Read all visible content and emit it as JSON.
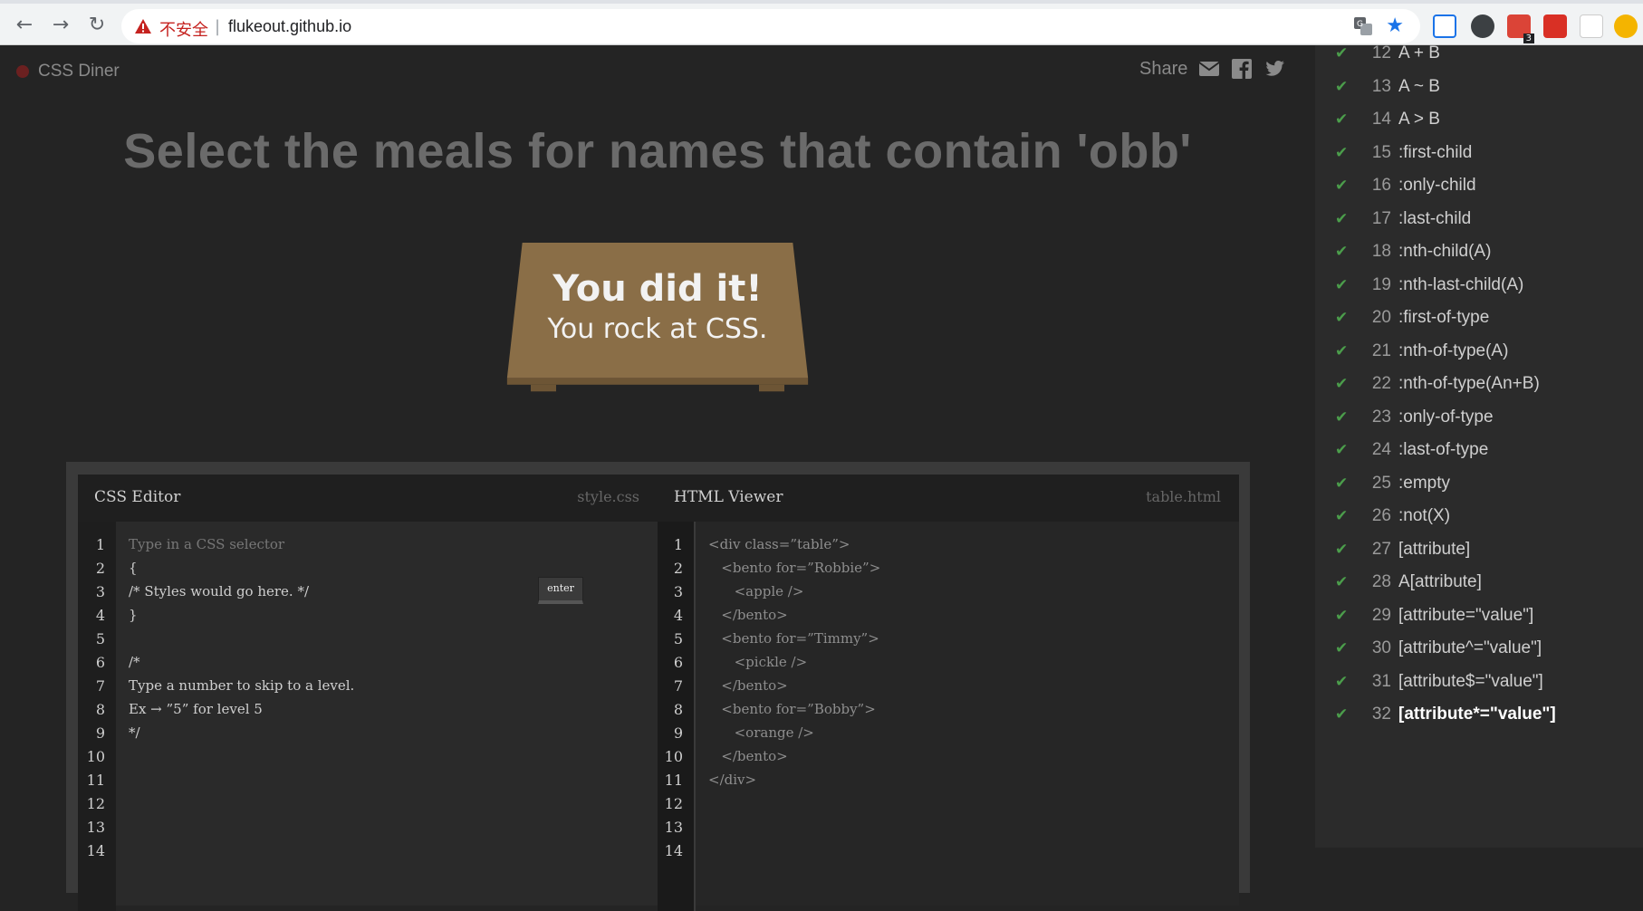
{
  "browser": {
    "security_label": "不安全",
    "separator": "|",
    "url": "flukeout.github.io",
    "extension_badge": "3"
  },
  "header": {
    "app_name": "CSS Diner",
    "share_label": "Share"
  },
  "order": "Select the meals for names that contain 'obb'",
  "table": {
    "message_title": "You did it!",
    "message_subtitle": "You rock at CSS."
  },
  "css_editor": {
    "title": "CSS Editor",
    "filename": "style.css",
    "enter_label": "enter",
    "input_placeholder": "Type in a CSS selector",
    "lines": [
      "{",
      "/* Styles would go here. */",
      "}",
      "",
      "/*",
      "Type a number to skip to a level.",
      "Ex → ”5” for level 5",
      "*/"
    ],
    "line_numbers": [
      "1",
      "2",
      "3",
      "4",
      "5",
      "6",
      "7",
      "8",
      "9",
      "10",
      "11",
      "12",
      "13",
      "14"
    ]
  },
  "html_viewer": {
    "title": "HTML Viewer",
    "filename": "table.html",
    "lines": [
      "<div class=”table”>",
      "   <bento for=”Robbie”>",
      "      <apple />",
      "   </bento>",
      "   <bento for=”Timmy”>",
      "      <pickle />",
      "   </bento>",
      "   <bento for=”Bobby”>",
      "      <orange />",
      "   </bento>",
      "</div>"
    ],
    "line_numbers": [
      "1",
      "2",
      "3",
      "4",
      "5",
      "6",
      "7",
      "8",
      "9",
      "10",
      "11",
      "12",
      "13",
      "14"
    ]
  },
  "levels": [
    {
      "num": "12",
      "name": "A + B",
      "done": true
    },
    {
      "num": "13",
      "name": "A ~ B",
      "done": true
    },
    {
      "num": "14",
      "name": "A > B",
      "done": true
    },
    {
      "num": "15",
      "name": ":first-child",
      "done": true
    },
    {
      "num": "16",
      "name": ":only-child",
      "done": true
    },
    {
      "num": "17",
      "name": ":last-child",
      "done": true
    },
    {
      "num": "18",
      "name": ":nth-child(A)",
      "done": true
    },
    {
      "num": "19",
      "name": ":nth-last-child(A)",
      "done": true
    },
    {
      "num": "20",
      "name": ":first-of-type",
      "done": true
    },
    {
      "num": "21",
      "name": ":nth-of-type(A)",
      "done": true
    },
    {
      "num": "22",
      "name": ":nth-of-type(An+B)",
      "done": true
    },
    {
      "num": "23",
      "name": ":only-of-type",
      "done": true
    },
    {
      "num": "24",
      "name": ":last-of-type",
      "done": true
    },
    {
      "num": "25",
      "name": ":empty",
      "done": true
    },
    {
      "num": "26",
      "name": ":not(X)",
      "done": true
    },
    {
      "num": "27",
      "name": "[attribute]",
      "done": true
    },
    {
      "num": "28",
      "name": "A[attribute]",
      "done": true
    },
    {
      "num": "29",
      "name": "[attribute=\"value\"]",
      "done": true
    },
    {
      "num": "30",
      "name": "[attribute^=\"value\"]",
      "done": true
    },
    {
      "num": "31",
      "name": "[attribute$=\"value\"]",
      "done": true
    },
    {
      "num": "32",
      "name": "[attribute*=\"value\"]",
      "done": true,
      "current": true
    }
  ],
  "colors": {
    "check": "#4b9d4b",
    "table_wood": "#8a6e47",
    "insecure_red": "#c5221f"
  }
}
